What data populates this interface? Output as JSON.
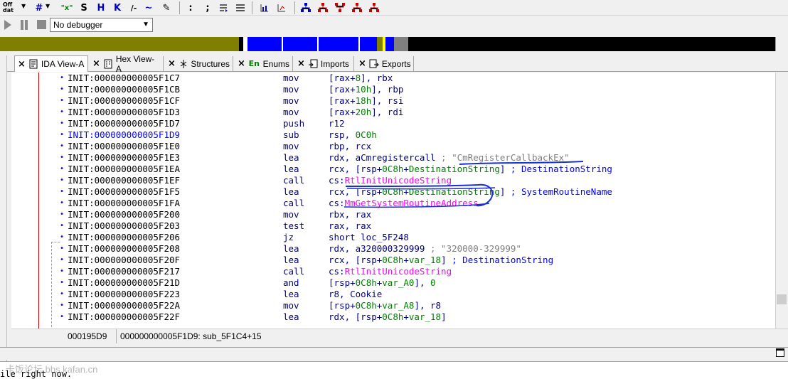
{
  "toolbar": {
    "buttons": [
      {
        "name": "offset-button",
        "label": "Off dat"
      },
      {
        "name": "number-button",
        "label": "#"
      },
      {
        "name": "hex-button",
        "label": "\"x\""
      },
      {
        "name": "string-button",
        "label": "S"
      },
      {
        "name": "struct-button",
        "label": "H"
      },
      {
        "name": "k-button",
        "label": "K"
      },
      {
        "name": "comment-button",
        "label": "/-"
      },
      {
        "name": "tilde-button",
        "label": "~"
      },
      {
        "name": "pen-button",
        "label": "✎"
      },
      {
        "name": "colon-button",
        "label": ":"
      },
      {
        "name": "semicolon-button",
        "label": ";"
      }
    ]
  },
  "debugger": {
    "selected": "No debugger"
  },
  "tabs": [
    {
      "label": "IDA View-A",
      "icon": "ida-view-icon"
    },
    {
      "label": "Hex View-A",
      "icon": "hex-view-icon"
    },
    {
      "label": "Structures",
      "icon": "structures-icon"
    },
    {
      "label": "Enums",
      "icon": "enums-icon",
      "icon_text": "En"
    },
    {
      "label": "Imports",
      "icon": "imports-icon"
    },
    {
      "label": "Exports",
      "icon": "exports-icon"
    }
  ],
  "code_lines": [
    {
      "addr": "INIT:000000000005F1C7",
      "mn": "mov",
      "op": "[rax+<g>8</g>], rbx"
    },
    {
      "addr": "INIT:000000000005F1CB",
      "mn": "mov",
      "op": "[rax+<g>10h</g>], rbp"
    },
    {
      "addr": "INIT:000000000005F1CF",
      "mn": "mov",
      "op": "[rax+<g>18h</g>], rsi"
    },
    {
      "addr": "INIT:000000000005F1D3",
      "mn": "mov",
      "op": "[rax+<g>20h</g>], rdi"
    },
    {
      "addr": "INIT:000000000005F1D7",
      "mn": "push",
      "op": "r12"
    },
    {
      "addr": "INIT:000000000005F1D9",
      "mn": "sub",
      "op": "rsp, <g>0C0h</g>",
      "highlight": true
    },
    {
      "addr": "INIT:000000000005F1E0",
      "mn": "mov",
      "op": "rbp, rcx"
    },
    {
      "addr": "INIT:000000000005F1E3",
      "mn": "lea",
      "op": "rdx, aCmregistercall <c>; \"CmRegisterCallbackEx\"</c>"
    },
    {
      "addr": "INIT:000000000005F1EA",
      "mn": "lea",
      "op": "rcx, [rsp+<g>0C8h</g>+<g>DestinationString</g>] <b>; DestinationString</b>"
    },
    {
      "addr": "INIT:000000000005F1EF",
      "mn": "call",
      "op": "cs:<p>RtlInitUnicodeString</p>"
    },
    {
      "addr": "INIT:000000000005F1F5",
      "mn": "lea",
      "op": "rcx, [rsp+<g>0C8h</g>+<g>DestinationString</g>] <b>; SystemRoutineName</b>"
    },
    {
      "addr": "INIT:000000000005F1FA",
      "mn": "call",
      "op": "cs:<p>MmGetSystemRoutineAddress</p>"
    },
    {
      "addr": "INIT:000000000005F200",
      "mn": "mov",
      "op": "rbx, rax"
    },
    {
      "addr": "INIT:000000000005F203",
      "mn": "test",
      "op": "rax, rax"
    },
    {
      "addr": "INIT:000000000005F206",
      "mn": "jz",
      "op": "short loc_5F248"
    },
    {
      "addr": "INIT:000000000005F208",
      "mn": "lea",
      "op": "rdx, a320000329999 <c>; \"320000-329999\"</c>"
    },
    {
      "addr": "INIT:000000000005F20F",
      "mn": "lea",
      "op": "rcx, [rsp+<g>0C8h</g>+<g>var_18</g>] <b>; DestinationString</b>"
    },
    {
      "addr": "INIT:000000000005F217",
      "mn": "call",
      "op": "cs:<p>RtlInitUnicodeString</p>"
    },
    {
      "addr": "INIT:000000000005F21D",
      "mn": "and",
      "op": "[rsp+<g>0C8h</g>+<g>var_A0</g>], <g>0</g>"
    },
    {
      "addr": "INIT:000000000005F223",
      "mn": "lea",
      "op": "r8, Cookie"
    },
    {
      "addr": "INIT:000000000005F22A",
      "mn": "mov",
      "op": "[rsp+<g>0C8h</g>+<g>var_A8</g>], r8"
    },
    {
      "addr": "INIT:000000000005F22F",
      "mn": "lea",
      "op": "rdx, [rsp+<g>0C8h</g>+<g>var_18</g>]"
    }
  ],
  "status": {
    "offset": "000195D9",
    "location": "000000000005F1D9: sub_5F1C4+15"
  },
  "output": {
    "text": "ile right now.",
    "watermark": "卡饭论坛 bbs.kafan.cn"
  },
  "colors": {
    "address": "#000000",
    "mnemonic": "#000080",
    "immediate": "#008000",
    "import": "#ff00ff",
    "comment": "#808080",
    "autocomment": "#0000ff"
  }
}
